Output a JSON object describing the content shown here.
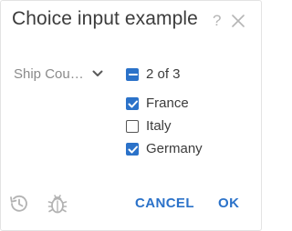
{
  "dialog": {
    "title": "Choice input example",
    "help_glyph": "?",
    "close_icon": "close-icon"
  },
  "field": {
    "label": "Ship Cou…",
    "icon": "chevron-down-icon"
  },
  "choices": {
    "summary": "2 of 3",
    "summary_state": "indeterminate",
    "items": [
      {
        "label": "France",
        "checked": true
      },
      {
        "label": "Italy",
        "checked": false
      },
      {
        "label": "Germany",
        "checked": true
      }
    ]
  },
  "footer": {
    "history_icon": "history-icon",
    "debug_icon": "bug-icon",
    "cancel_label": "CANCEL",
    "ok_label": "OK"
  },
  "colors": {
    "accent": "#2b72c9",
    "text": "#3c3c3c",
    "muted": "#8a8a8a"
  }
}
